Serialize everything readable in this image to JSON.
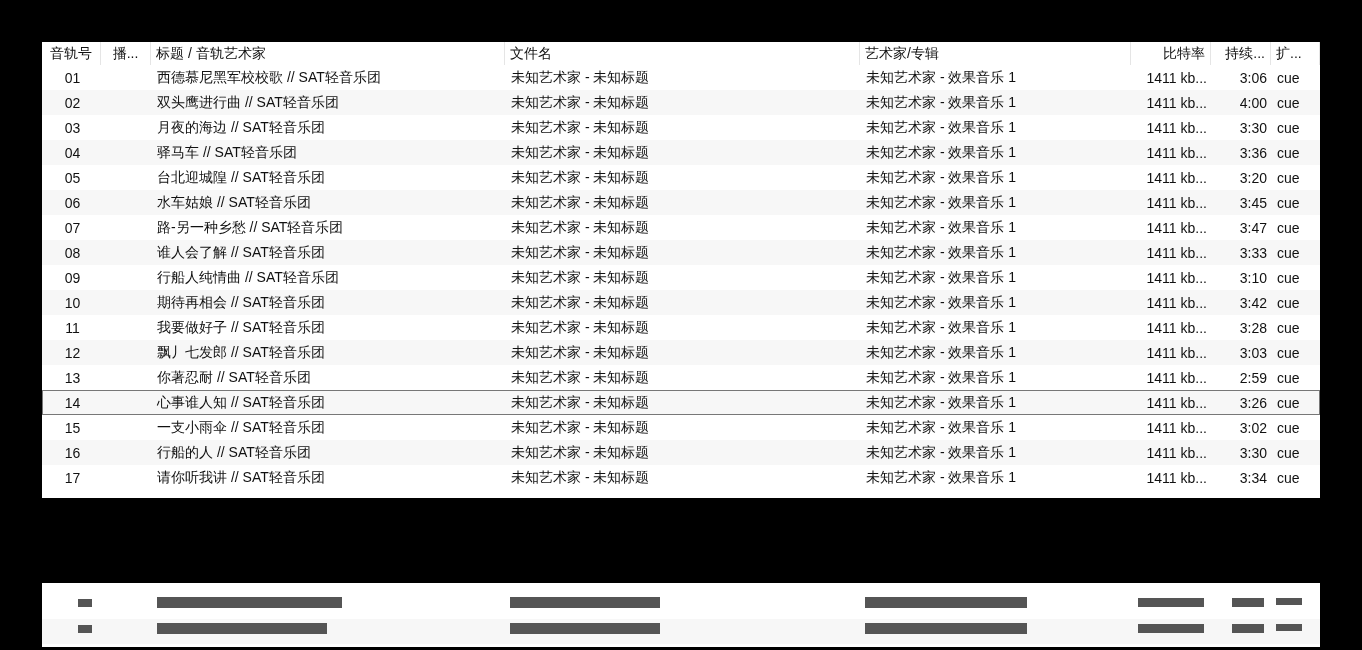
{
  "table": {
    "columns": [
      "音轨号",
      "播...",
      "标题 / 音轨艺术家",
      "文件名",
      "艺术家/专辑",
      "比特率",
      "持续...",
      "扩..."
    ],
    "rows": [
      {
        "cells": [
          "01",
          "",
          "西德慕尼黑军校校歌 // SAT轻音乐团",
          "未知艺术家 - 未知标题",
          "未知艺术家 - 效果音乐 1",
          "1411 kb...",
          "3:06",
          "cue"
        ],
        "selected": false
      },
      {
        "cells": [
          "02",
          "",
          "双头鹰进行曲 // SAT轻音乐团",
          "未知艺术家 - 未知标题",
          "未知艺术家 - 效果音乐 1",
          "1411 kb...",
          "4:00",
          "cue"
        ],
        "selected": false
      },
      {
        "cells": [
          "03",
          "",
          "月夜的海边 // SAT轻音乐团",
          "未知艺术家 - 未知标题",
          "未知艺术家 - 效果音乐 1",
          "1411 kb...",
          "3:30",
          "cue"
        ],
        "selected": false
      },
      {
        "cells": [
          "04",
          "",
          "驿马车 // SAT轻音乐团",
          "未知艺术家 - 未知标题",
          "未知艺术家 - 效果音乐 1",
          "1411 kb...",
          "3:36",
          "cue"
        ],
        "selected": false
      },
      {
        "cells": [
          "05",
          "",
          "台北迎城隍 // SAT轻音乐团",
          "未知艺术家 - 未知标题",
          "未知艺术家 - 效果音乐 1",
          "1411 kb...",
          "3:20",
          "cue"
        ],
        "selected": false
      },
      {
        "cells": [
          "06",
          "",
          "水车姑娘 // SAT轻音乐团",
          "未知艺术家 - 未知标题",
          "未知艺术家 - 效果音乐 1",
          "1411 kb...",
          "3:45",
          "cue"
        ],
        "selected": false
      },
      {
        "cells": [
          "07",
          "",
          "路-另一种乡愁 // SAT轻音乐团",
          "未知艺术家 - 未知标题",
          "未知艺术家 - 效果音乐 1",
          "1411 kb...",
          "3:47",
          "cue"
        ],
        "selected": false
      },
      {
        "cells": [
          "08",
          "",
          "谁人会了解 // SAT轻音乐团",
          "未知艺术家 - 未知标题",
          "未知艺术家 - 效果音乐 1",
          "1411 kb...",
          "3:33",
          "cue"
        ],
        "selected": false
      },
      {
        "cells": [
          "09",
          "",
          "行船人纯情曲 // SAT轻音乐团",
          "未知艺术家 - 未知标题",
          "未知艺术家 - 效果音乐 1",
          "1411 kb...",
          "3:10",
          "cue"
        ],
        "selected": false
      },
      {
        "cells": [
          "10",
          "",
          "期待再相会 // SAT轻音乐团",
          "未知艺术家 - 未知标题",
          "未知艺术家 - 效果音乐 1",
          "1411 kb...",
          "3:42",
          "cue"
        ],
        "selected": false
      },
      {
        "cells": [
          "11",
          "",
          "我要做好子 // SAT轻音乐团",
          "未知艺术家 - 未知标题",
          "未知艺术家 - 效果音乐 1",
          "1411 kb...",
          "3:28",
          "cue"
        ],
        "selected": false
      },
      {
        "cells": [
          "12",
          "",
          "飘丿七发郎 // SAT轻音乐团",
          "未知艺术家 - 未知标题",
          "未知艺术家 - 效果音乐 1",
          "1411 kb...",
          "3:03",
          "cue"
        ],
        "selected": false
      },
      {
        "cells": [
          "13",
          "",
          "你著忍耐 // SAT轻音乐团",
          "未知艺术家 - 未知标题",
          "未知艺术家 - 效果音乐 1",
          "1411 kb...",
          "2:59",
          "cue"
        ],
        "selected": false
      },
      {
        "cells": [
          "14",
          "",
          "心事谁人知 // SAT轻音乐团",
          "未知艺术家 - 未知标题",
          "未知艺术家 - 效果音乐 1",
          "1411 kb...",
          "3:26",
          "cue"
        ],
        "selected": true
      },
      {
        "cells": [
          "15",
          "",
          "一支小雨伞 // SAT轻音乐团",
          "未知艺术家 - 未知标题",
          "未知艺术家 - 效果音乐 1",
          "1411 kb...",
          "3:02",
          "cue"
        ],
        "selected": false
      },
      {
        "cells": [
          "16",
          "",
          "行船的人 // SAT轻音乐团",
          "未知艺术家 - 未知标题",
          "未知艺术家 - 效果音乐 1",
          "1411 kb...",
          "3:30",
          "cue"
        ],
        "selected": false
      },
      {
        "cells": [
          "17",
          "",
          "请你听我讲 // SAT轻音乐团",
          "未知艺术家 - 未知标题",
          "未知艺术家 - 效果音乐 1",
          "1411 kb...",
          "3:34",
          "cue"
        ],
        "selected": false
      }
    ]
  }
}
